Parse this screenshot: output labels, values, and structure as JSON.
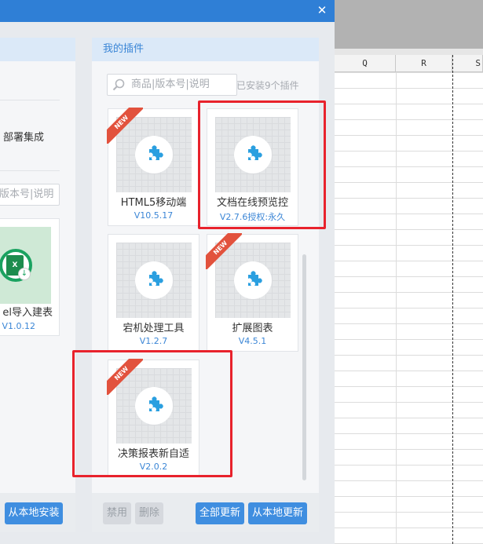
{
  "dialog": {
    "close_glyph": "✕",
    "left_panel": {
      "deploy_text": "部署集成",
      "search_placeholder_fragment": "版本号|说明",
      "card": {
        "name": "el导入建表",
        "version": "V1.0.12"
      },
      "local_install_label": "从本地安装"
    },
    "right_panel": {
      "title": "我的插件",
      "search_placeholder": "商品|版本号|说明",
      "installed_count": "已安装9个插件",
      "badge_new": "NEW",
      "plugins": [
        {
          "name": "HTML5移动端",
          "version": "V10.5.17",
          "is_new": true,
          "highlighted": false
        },
        {
          "name": "文档在线预览控",
          "version": "V2.7.6授权:永久",
          "is_new": false,
          "highlighted": true
        },
        {
          "name": "宕机处理工具",
          "version": "V1.2.7",
          "is_new": false,
          "highlighted": false
        },
        {
          "name": "扩展图表",
          "version": "V4.5.1",
          "is_new": true,
          "highlighted": false
        },
        {
          "name": "决策报表新自适",
          "version": "V2.0.2",
          "is_new": true,
          "highlighted": true
        }
      ],
      "footer": {
        "disable_label": "禁用",
        "delete_label": "删除",
        "update_all_label": "全部更新",
        "update_local_label": "从本地更新"
      }
    }
  },
  "spreadsheet": {
    "columns": [
      "Q",
      "R",
      "S"
    ]
  },
  "colors": {
    "accent": "#3f8ee0",
    "titlebar": "#2f7fd6",
    "new_badge": "#e2523d",
    "highlight": "#e8222c",
    "puzzle": "#2a9fe0"
  },
  "icons": {
    "close": "close-icon",
    "search": "search-icon",
    "plugin": "puzzle-icon",
    "excel": "excel-icon"
  }
}
